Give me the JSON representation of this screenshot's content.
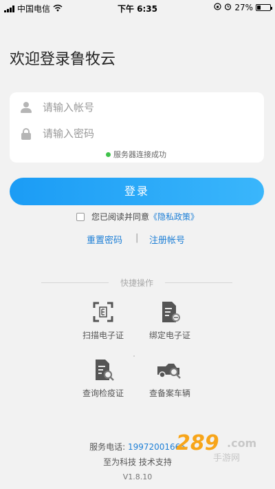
{
  "status_bar": {
    "carrier": "中国电信",
    "time": "下午 6:35",
    "battery_percent": "27%",
    "battery_level": 0.27
  },
  "title": "欢迎登录鲁牧云",
  "login_form": {
    "account_placeholder": "请输入帐号",
    "password_placeholder": "请输入密码",
    "server_status": "服务器连接成功"
  },
  "login_button": "登录",
  "agreement": {
    "text": "您已阅读并同意",
    "policy": "《隐私政策》"
  },
  "links": {
    "reset_password": "重置密码",
    "separator": "|",
    "register": "注册帐号"
  },
  "quick_actions": {
    "title": "快捷操作",
    "items": [
      {
        "label": "扫描电子证",
        "icon": "scan-icon"
      },
      {
        "label": "绑定电子证",
        "icon": "bind-certificate-icon"
      },
      {
        "label": "查询检疫证",
        "icon": "query-certificate-icon"
      },
      {
        "label": "查备案车辆",
        "icon": "vehicle-search-icon"
      }
    ]
  },
  "footer": {
    "hotline_label": "服务电话:",
    "hotline_number": "19972001665",
    "support": "至为科技 技术支持",
    "version": "V1.8.10"
  },
  "watermark": {
    "main": "289",
    "com": ".com",
    "sub": "手游网"
  },
  "colors": {
    "accent": "#1d7fd6",
    "button_start": "#1b9cf5",
    "button_end": "#3ab6fb",
    "success": "#3fc24a"
  }
}
